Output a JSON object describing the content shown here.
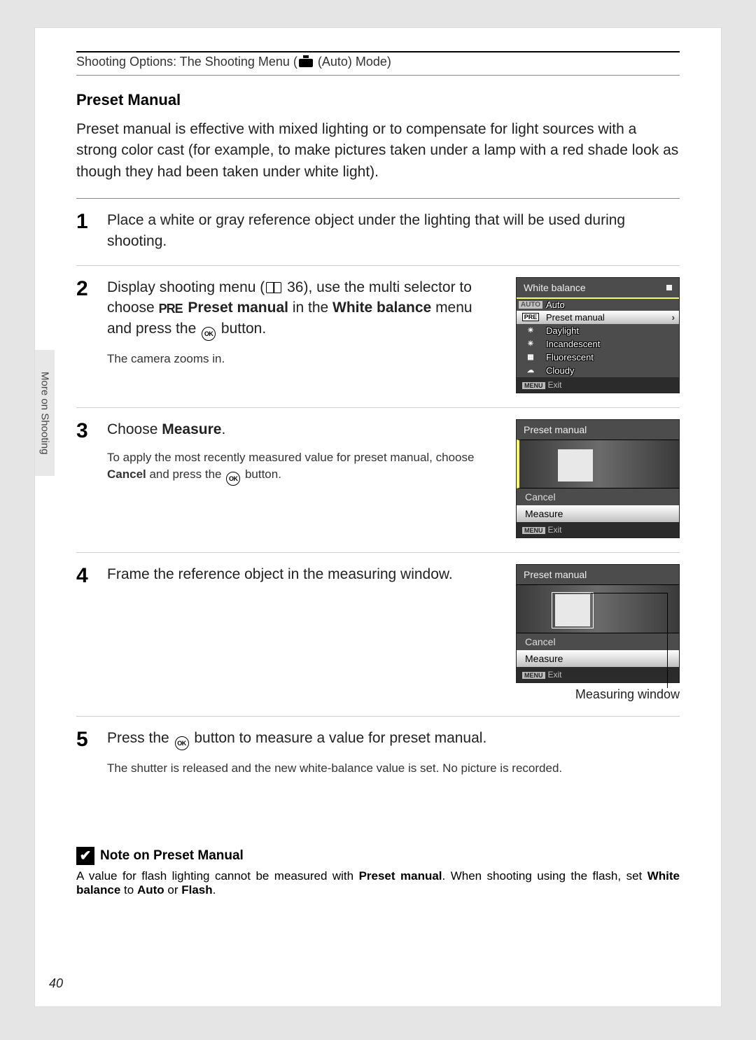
{
  "header": {
    "breadcrumb_pre": "Shooting Options: The Shooting Menu (",
    "breadcrumb_post": " (Auto) Mode)"
  },
  "side_tab": "More on Shooting",
  "section_title": "Preset Manual",
  "intro": "Preset manual is effective with mixed lighting or to compensate for light sources with a strong color cast (for example, to make pictures taken under a lamp with a red shade look as though they had been taken under white light).",
  "steps": {
    "s1": {
      "num": "1",
      "text": "Place a white or gray reference object under the lighting that will be used during shooting."
    },
    "s2": {
      "num": "2",
      "text_a": "Display shooting menu (",
      "text_b": " 36), use the multi selector to choose ",
      "text_c": " Preset manual",
      "text_d": " in the ",
      "text_e": "White balance",
      "text_f": " menu and press the ",
      "text_g": " button.",
      "sub": "The camera zooms in.",
      "screen": {
        "title": "White balance",
        "rows": {
          "auto": "Auto",
          "preset": "Preset manual",
          "daylight": "Daylight",
          "incan": "Incandescent",
          "fluor": "Fluorescent",
          "cloudy": "Cloudy"
        },
        "exit": "Exit",
        "auto_icon": "AUTO",
        "pre_icon": "PRE"
      }
    },
    "s3": {
      "num": "3",
      "main_a": "Choose ",
      "main_b": "Measure",
      "main_c": ".",
      "sub_a": "To apply the most recently measured value for preset manual, choose ",
      "sub_b": "Cancel",
      "sub_c": " and press the ",
      "sub_d": " button.",
      "screen": {
        "title": "Preset manual",
        "cancel": "Cancel",
        "measure": "Measure",
        "exit": "Exit"
      }
    },
    "s4": {
      "num": "4",
      "text": "Frame the reference object in the measuring window.",
      "caption": "Measuring window",
      "screen": {
        "title": "Preset manual",
        "cancel": "Cancel",
        "measure": "Measure",
        "exit": "Exit"
      }
    },
    "s5": {
      "num": "5",
      "main_a": "Press the ",
      "main_b": " button to measure a value for preset manual.",
      "sub": "The shutter is released and the new white-balance value is set. No picture is recorded."
    }
  },
  "note": {
    "title": "Note on Preset Manual",
    "body_a": "A value for flash lighting cannot be measured with ",
    "body_b": "Preset manual",
    "body_c": ". When shooting using the flash, set ",
    "body_d": "White balance",
    "body_e": " to ",
    "body_f": "Auto",
    "body_g": " or ",
    "body_h": "Flash",
    "body_i": "."
  },
  "page_num": "40",
  "pre_glyph": "PRE",
  "menu_tag": "MENU"
}
